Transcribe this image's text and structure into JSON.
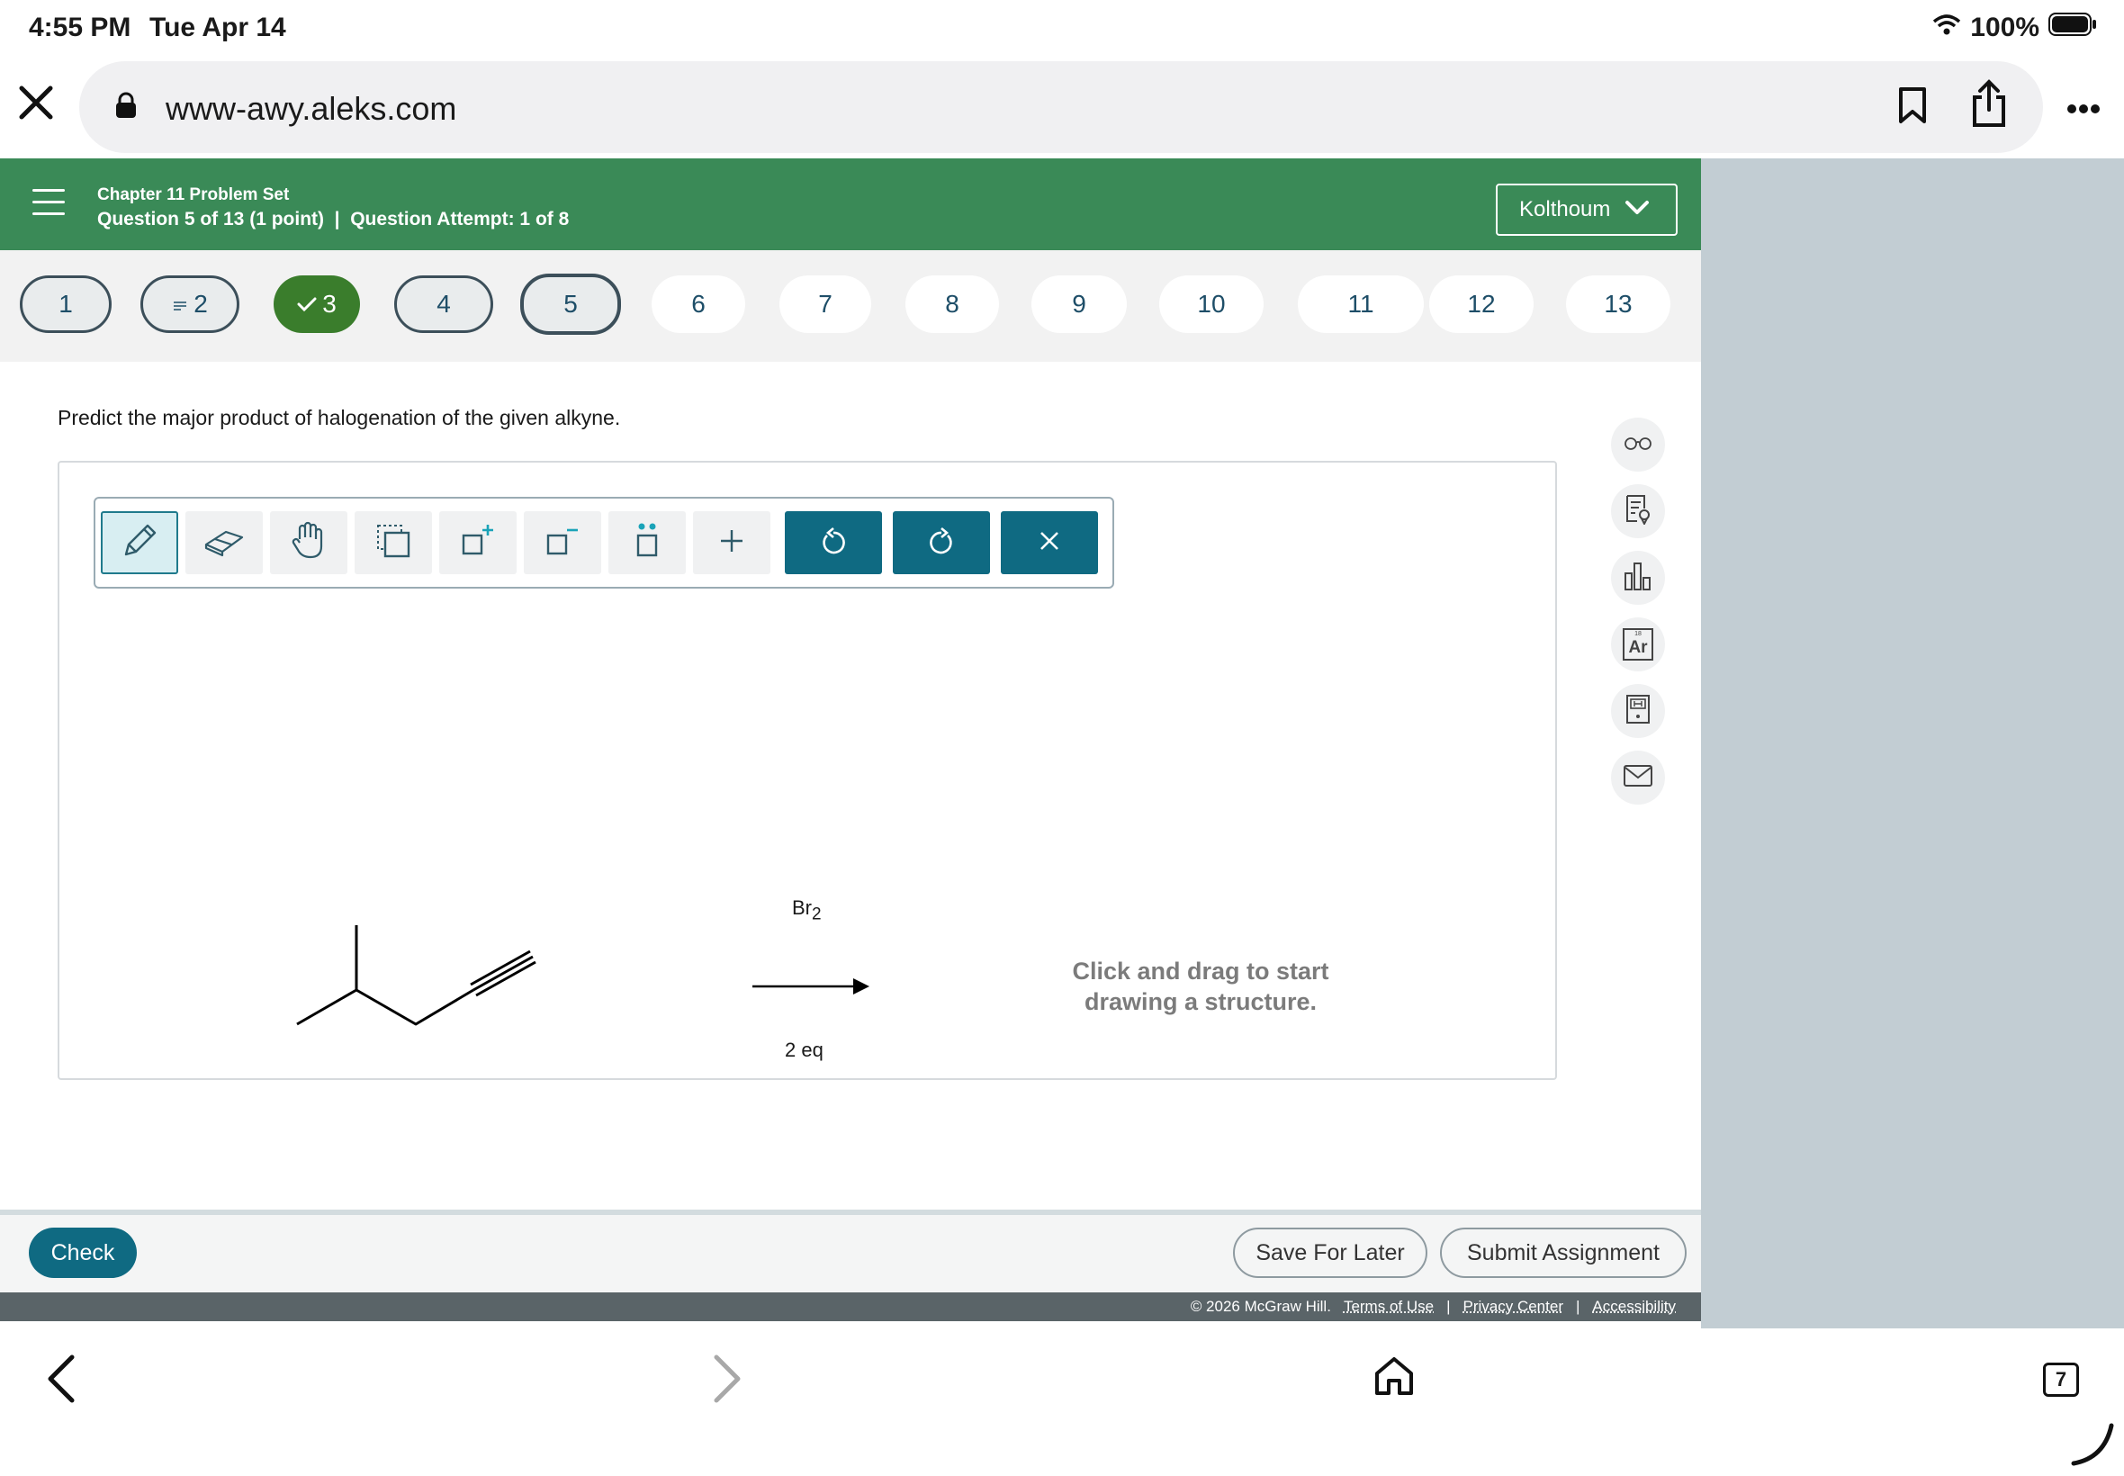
{
  "status": {
    "time": "4:55 PM",
    "date": "Tue Apr 14",
    "battery": "100%"
  },
  "browser": {
    "url": "www-awy.aleks.com",
    "tabs_count": "7"
  },
  "header": {
    "chapter": "Chapter 11 Problem Set",
    "question_info": "Question 5 of 13 (1 point)  |  Question Attempt: 1 of 8",
    "user_name": "Kolthoum"
  },
  "question_nav": [
    {
      "label": "1",
      "state": "visited"
    },
    {
      "label": "2",
      "state": "visited",
      "icon": "list-icon"
    },
    {
      "label": "3",
      "state": "done",
      "icon": "check-icon"
    },
    {
      "label": "4",
      "state": "visited"
    },
    {
      "label": "5",
      "state": "current"
    },
    {
      "label": "6",
      "state": "unvisited"
    },
    {
      "label": "7",
      "state": "unvisited"
    },
    {
      "label": "8",
      "state": "unvisited"
    },
    {
      "label": "9",
      "state": "unvisited"
    },
    {
      "label": "10",
      "state": "unvisited"
    },
    {
      "label": "11",
      "state": "unvisited"
    },
    {
      "label": "12",
      "state": "unvisited"
    },
    {
      "label": "13",
      "state": "unvisited"
    }
  ],
  "question": {
    "prompt": "Predict the major product of halogenation of the given alkyne.",
    "reagent_main": "Br",
    "reagent_sub": "2",
    "reagent_amount": "2 eq",
    "hint_line1": "Click and drag to start",
    "hint_line2": "drawing a structure."
  },
  "toolbar": [
    "pencil-icon",
    "eraser-icon",
    "hand-icon",
    "select-icon",
    "add-charge-icon",
    "remove-charge-icon",
    "lone-pair-icon",
    "plus-icon",
    "undo-icon",
    "redo-icon",
    "clear-icon"
  ],
  "side_tools": [
    "glasses-icon",
    "notes-icon",
    "chart-icon",
    "periodic-table-icon",
    "calculator-icon",
    "mail-icon"
  ],
  "side_tool_text": {
    "periodic_symbol": "Ar",
    "periodic_number": "18"
  },
  "actions": {
    "check": "Check",
    "save": "Save For Later",
    "submit": "Submit Assignment"
  },
  "footer": {
    "copyright": "© 2026 McGraw Hill.",
    "terms": "Terms of Use",
    "privacy": "Privacy Center",
    "accessibility": "Accessibility",
    "separator": "|"
  },
  "colors": {
    "header_green": "#3a8a57",
    "done_green": "#3a7d2c",
    "teal": "#0f6a82",
    "side_gray": "#c2cdd3"
  }
}
